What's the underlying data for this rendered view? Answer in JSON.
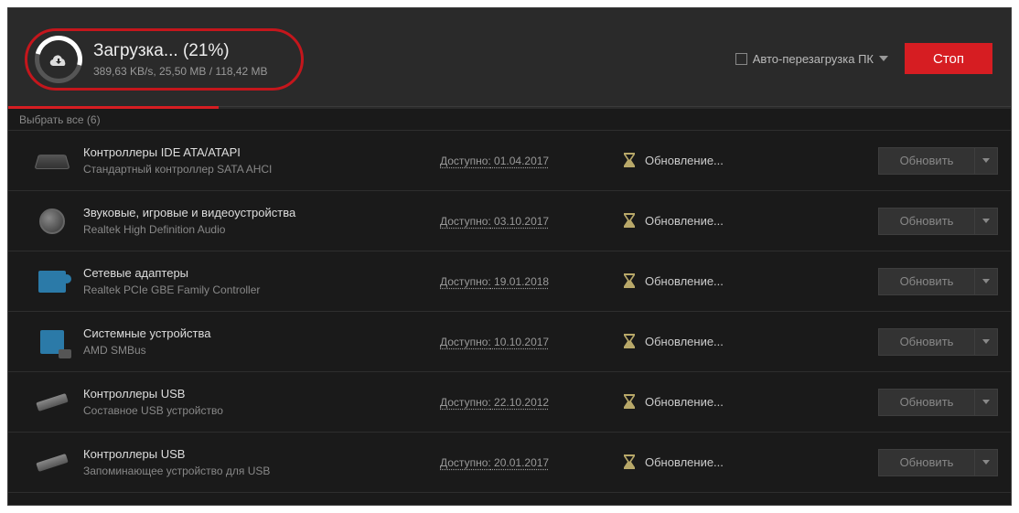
{
  "header": {
    "title_prefix": "Загрузка...",
    "percent": "(21%)",
    "stats": "389,63 KB/s, 25,50 MB / 118,42 MB",
    "auto_restart_label": "Авто-перезагрузка ПК",
    "stop_label": "Стоп"
  },
  "select_all": "Выбрать все (6)",
  "row_common": {
    "avail_prefix": "Доступно:",
    "status_label": "Обновление...",
    "update_label": "Обновить"
  },
  "rows": [
    {
      "title": "Контроллеры IDE ATA/ATAPI",
      "sub": "Стандартный контроллер SATA AHCI",
      "date": "01.04.2017",
      "icon": "card"
    },
    {
      "title": "Звуковые, игровые и видеоустройства",
      "sub": "Realtek High Definition Audio",
      "date": "03.10.2017",
      "icon": "speaker"
    },
    {
      "title": "Сетевые адаптеры",
      "sub": "Realtek PCIe GBE Family Controller",
      "date": "19.01.2018",
      "icon": "net"
    },
    {
      "title": "Системные устройства",
      "sub": "AMD SMBus",
      "date": "10.10.2017",
      "icon": "sys"
    },
    {
      "title": "Контроллеры USB",
      "sub": "Составное USB устройство",
      "date": "22.10.2012",
      "icon": "usb"
    },
    {
      "title": "Контроллеры USB",
      "sub": "Запоминающее устройство для USB",
      "date": "20.01.2017",
      "icon": "usb"
    }
  ]
}
